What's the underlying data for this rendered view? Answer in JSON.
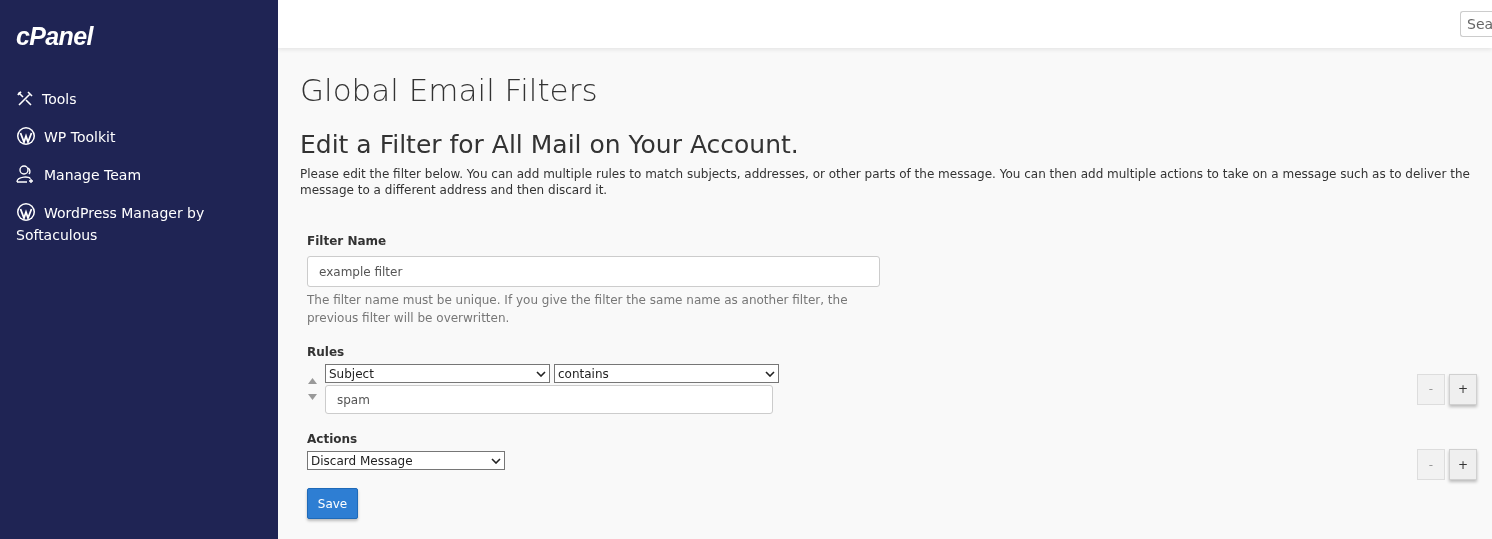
{
  "sidebar": {
    "logo": "cPanel",
    "items": [
      {
        "kind": "tools",
        "label": "Tools"
      },
      {
        "kind": "wordpress",
        "label": "WP Toolkit"
      },
      {
        "kind": "team",
        "label": "Manage Team"
      },
      {
        "kind": "wordpress",
        "label": "WordPress Manager by Softaculous"
      }
    ]
  },
  "header": {
    "search": {
      "placeholder": "Sea"
    }
  },
  "page_title": "Global Email Filters",
  "heading": "Edit a Filter for All Mail on Your Account.",
  "description": "Please edit the filter below. You can add multiple rules to match subjects, addresses, or other parts of the message. You can then add multiple actions to take on a message such as to deliver the message to a different address and then discard it.",
  "filter_name": {
    "label": "Filter Name",
    "value": "example filter",
    "help": "The filter name must be unique. If you give the filter the same name as another filter, the previous filter will be overwritten."
  },
  "rules": {
    "label": "Rules",
    "items": [
      {
        "part": "Subject",
        "match": "contains",
        "value": "spam",
        "remove_button": {
          "label": "-",
          "disabled": true
        },
        "add_button": {
          "label": "+",
          "disabled": false
        }
      }
    ]
  },
  "actions": {
    "label": "Actions",
    "items": [
      {
        "action": "Discard Message",
        "remove_button": {
          "label": "-",
          "disabled": true
        },
        "add_button": {
          "label": "+",
          "disabled": false
        }
      }
    ]
  },
  "save_button": "Save"
}
